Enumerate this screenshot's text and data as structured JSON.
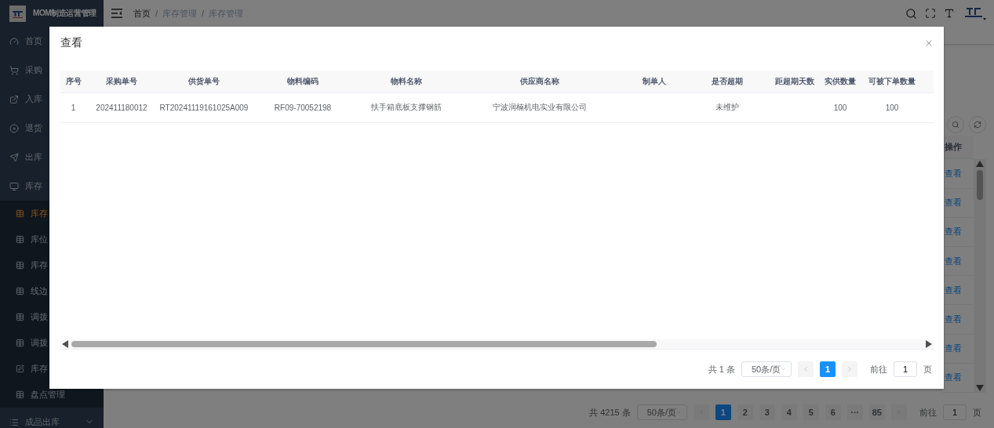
{
  "app": {
    "title": "MOM制造运营管理"
  },
  "sidebar": {
    "items": [
      {
        "label": "首页"
      },
      {
        "label": "采购"
      },
      {
        "label": "入库"
      },
      {
        "label": "退货"
      },
      {
        "label": "出库"
      },
      {
        "label": "库存",
        "children": [
          {
            "label": "库存",
            "selected": true
          },
          {
            "label": "库位",
            "selected": false
          },
          {
            "label": "库存",
            "selected": false
          },
          {
            "label": "线边",
            "selected": false
          },
          {
            "label": "调拨",
            "selected": false
          },
          {
            "label": "调拨",
            "selected": false
          },
          {
            "label": "库存",
            "selected": false
          },
          {
            "label": "盘点管理",
            "selected": false
          }
        ]
      },
      {
        "label": "成品出库",
        "expanded": false
      }
    ]
  },
  "breadcrumb": [
    "首页",
    "库存管理",
    "库存管理"
  ],
  "breadcrumb_separator": "/",
  "background_table": {
    "header": "操作",
    "rows": [
      "查看",
      "查看",
      "查看",
      "查看",
      "查看",
      "查看",
      "查看",
      "查看"
    ]
  },
  "background_pagination": {
    "total": "共 4215 条",
    "page_size": "50条/页",
    "pages": [
      {
        "label": "1",
        "selected": true
      },
      {
        "label": "2",
        "selected": false
      },
      {
        "label": "3",
        "selected": false
      },
      {
        "label": "4",
        "selected": false
      },
      {
        "label": "5",
        "selected": false
      },
      {
        "label": "6",
        "selected": false
      },
      {
        "label": "···",
        "selected": false
      },
      {
        "label": "85",
        "selected": false
      }
    ],
    "goto_label": "前往",
    "goto_value": "1",
    "goto_suffix": "页"
  },
  "dialog": {
    "title": "查看",
    "columns": [
      "序号",
      "采购单号",
      "供货单号",
      "物料编码",
      "物料名称",
      "供应商名称",
      "制单人",
      "是否超期",
      "距超期天数",
      "实供数量",
      "可被下单数量"
    ],
    "rows": [
      [
        "1",
        "202411180012",
        "RT20241119161025A009",
        "RF09-70052198",
        "扶手箱底板支撑钢筋",
        "宁波润楠机电实业有限公司",
        null,
        "未维护",
        null,
        "100",
        "100"
      ]
    ],
    "pagination": {
      "total": "共 1 条",
      "page_size": "50条/页",
      "pages": [
        {
          "label": "1",
          "selected": true
        }
      ],
      "goto_label": "前往",
      "goto_value": "1",
      "goto_suffix": "页"
    }
  }
}
